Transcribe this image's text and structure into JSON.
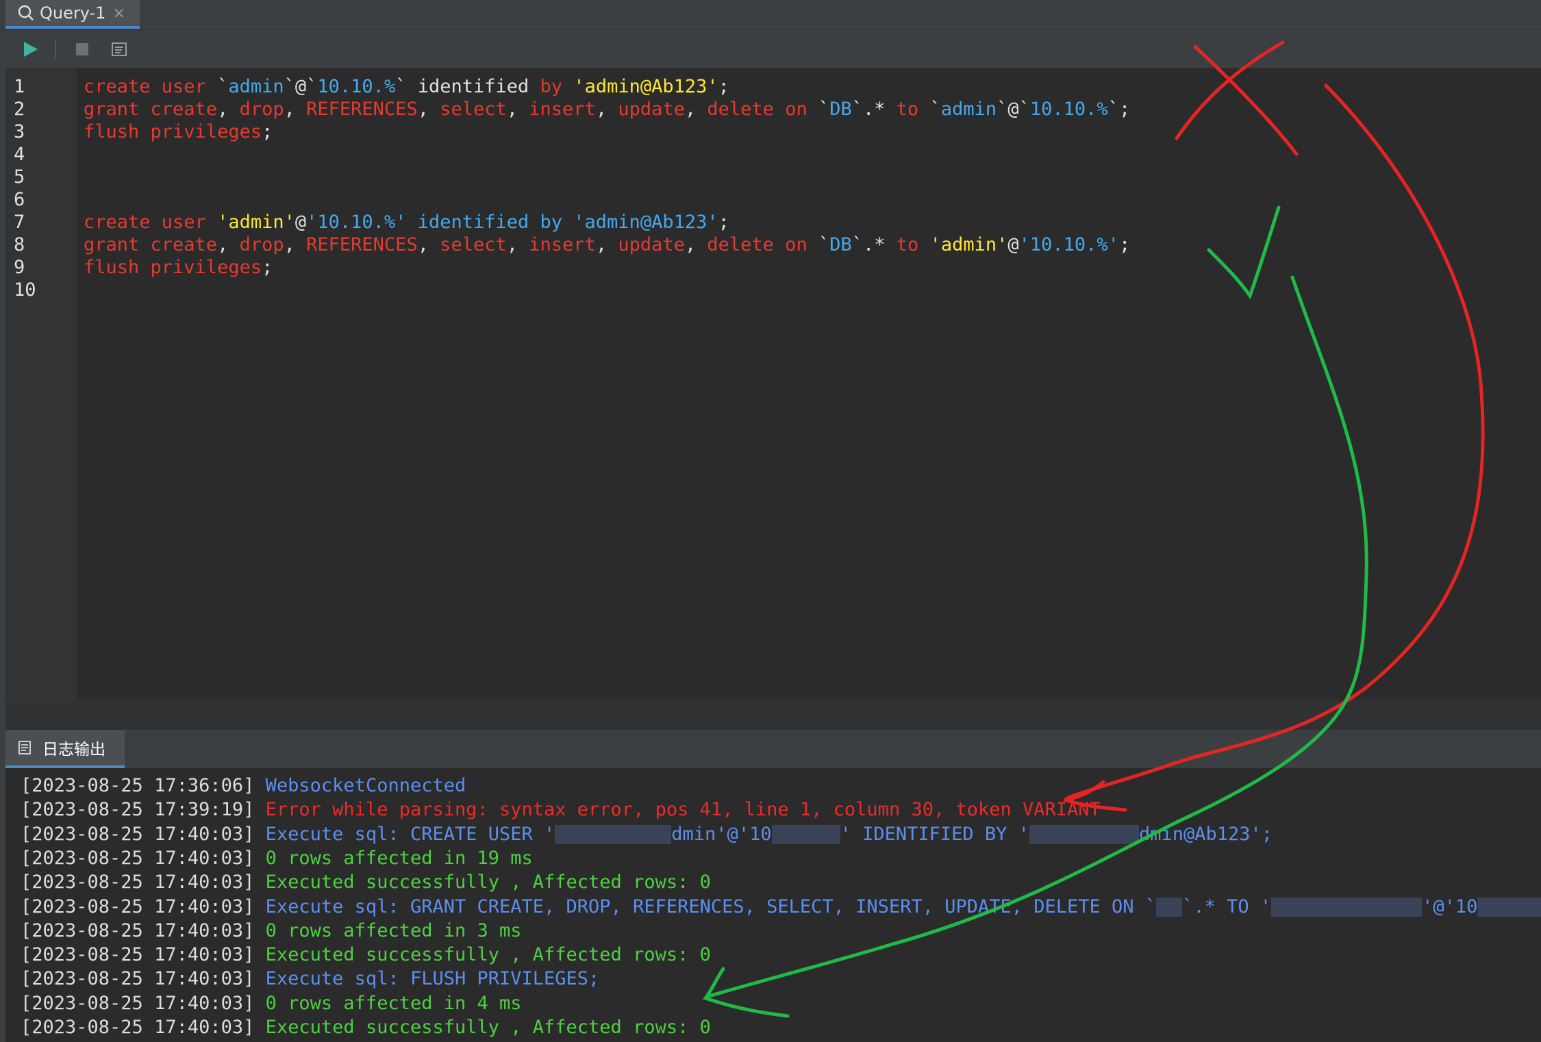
{
  "tab": {
    "title": "Query-1",
    "close_icon": "×"
  },
  "toolbar": {
    "run_icon": "play-icon",
    "stop_icon": "stop-icon",
    "format_icon": "format-icon"
  },
  "editor": {
    "lines": [
      {
        "num": "1",
        "tokens": [
          {
            "t": "create user ",
            "c": "kw"
          },
          {
            "t": "`",
            "c": "plain"
          },
          {
            "t": "admin",
            "c": "ident"
          },
          {
            "t": "`@`",
            "c": "plain"
          },
          {
            "t": "10.10.%",
            "c": "ident"
          },
          {
            "t": "` ",
            "c": "plain"
          },
          {
            "t": "identified ",
            "c": "plain"
          },
          {
            "t": "by ",
            "c": "kw"
          },
          {
            "t": "'admin@Ab123'",
            "c": "str"
          },
          {
            "t": ";",
            "c": "plain"
          }
        ]
      },
      {
        "num": "2",
        "tokens": [
          {
            "t": "grant create",
            "c": "kw"
          },
          {
            "t": ", ",
            "c": "plain"
          },
          {
            "t": "drop",
            "c": "kw"
          },
          {
            "t": ", ",
            "c": "plain"
          },
          {
            "t": "REFERENCES",
            "c": "kw"
          },
          {
            "t": ", ",
            "c": "plain"
          },
          {
            "t": "select",
            "c": "kw"
          },
          {
            "t": ", ",
            "c": "plain"
          },
          {
            "t": "insert",
            "c": "kw"
          },
          {
            "t": ", ",
            "c": "plain"
          },
          {
            "t": "update",
            "c": "kw"
          },
          {
            "t": ", ",
            "c": "plain"
          },
          {
            "t": "delete on ",
            "c": "kw"
          },
          {
            "t": "`",
            "c": "plain"
          },
          {
            "t": "DB",
            "c": "ident"
          },
          {
            "t": "`.* ",
            "c": "plain"
          },
          {
            "t": "to ",
            "c": "kw"
          },
          {
            "t": "`",
            "c": "plain"
          },
          {
            "t": "admin",
            "c": "ident"
          },
          {
            "t": "`@`",
            "c": "plain"
          },
          {
            "t": "10.10.%",
            "c": "ident"
          },
          {
            "t": "`;",
            "c": "plain"
          }
        ]
      },
      {
        "num": "3",
        "tokens": [
          {
            "t": "flush privileges",
            "c": "kw"
          },
          {
            "t": ";",
            "c": "plain"
          }
        ]
      },
      {
        "num": "4",
        "tokens": []
      },
      {
        "num": "5",
        "tokens": []
      },
      {
        "num": "6",
        "tokens": []
      },
      {
        "num": "7",
        "tokens": [
          {
            "t": "create user ",
            "c": "kw"
          },
          {
            "t": "'admin'",
            "c": "str"
          },
          {
            "t": "@",
            "c": "plain"
          },
          {
            "t": "'10.10.%' ",
            "c": "ident"
          },
          {
            "t": "identified by ",
            "c": "ident"
          },
          {
            "t": "'admin@Ab123'",
            "c": "ident"
          },
          {
            "t": ";",
            "c": "plain"
          }
        ]
      },
      {
        "num": "8",
        "tokens": [
          {
            "t": "grant create",
            "c": "kw"
          },
          {
            "t": ", ",
            "c": "plain"
          },
          {
            "t": "drop",
            "c": "kw"
          },
          {
            "t": ", ",
            "c": "plain"
          },
          {
            "t": "REFERENCES",
            "c": "kw"
          },
          {
            "t": ", ",
            "c": "plain"
          },
          {
            "t": "select",
            "c": "kw"
          },
          {
            "t": ", ",
            "c": "plain"
          },
          {
            "t": "insert",
            "c": "kw"
          },
          {
            "t": ", ",
            "c": "plain"
          },
          {
            "t": "update",
            "c": "kw"
          },
          {
            "t": ", ",
            "c": "plain"
          },
          {
            "t": "delete on ",
            "c": "kw"
          },
          {
            "t": "`",
            "c": "plain"
          },
          {
            "t": "DB",
            "c": "ident"
          },
          {
            "t": "`.* ",
            "c": "plain"
          },
          {
            "t": "to ",
            "c": "kw"
          },
          {
            "t": "'admin'",
            "c": "str"
          },
          {
            "t": "@",
            "c": "plain"
          },
          {
            "t": "'10.10.%'",
            "c": "ident"
          },
          {
            "t": ";",
            "c": "plain"
          }
        ]
      },
      {
        "num": "9",
        "tokens": [
          {
            "t": "flush privileges",
            "c": "kw"
          },
          {
            "t": ";",
            "c": "plain"
          }
        ]
      },
      {
        "num": "10",
        "tokens": []
      }
    ]
  },
  "log": {
    "tab_label": "日志输出",
    "entries": [
      {
        "ts": "[2023-08-25 17:36:06]",
        "msg": "WebsocketConnected",
        "color": "blue"
      },
      {
        "ts": "[2023-08-25 17:39:19]",
        "msg": "Error while parsing: syntax error, pos 41, line 1, column 30, token VARIANT",
        "color": "red"
      },
      {
        "ts": "[2023-08-25 17:40:03]",
        "msg": "Execute sql: CREATE USER '",
        "msg2": "dmin'@'10",
        "msg3": "' IDENTIFIED BY '",
        "msg4": "dmin@Ab123';",
        "color": "blue",
        "redacted": true
      },
      {
        "ts": "[2023-08-25 17:40:03]",
        "msg": "0 rows affected in 19 ms",
        "color": "green"
      },
      {
        "ts": "[2023-08-25 17:40:03]",
        "msg": "Executed successfully , Affected rows: 0",
        "color": "green"
      },
      {
        "ts": "[2023-08-25 17:40:03]",
        "msg": "Execute sql: GRANT CREATE, DROP, REFERENCES, SELECT, INSERT, UPDATE, DELETE ON `",
        "msg2": "`.* TO '",
        "msg3": "'@'10",
        "msg4": "';",
        "color": "blue",
        "redacted": true
      },
      {
        "ts": "[2023-08-25 17:40:03]",
        "msg": "0 rows affected in 3 ms",
        "color": "green"
      },
      {
        "ts": "[2023-08-25 17:40:03]",
        "msg": "Executed successfully , Affected rows: 0",
        "color": "green"
      },
      {
        "ts": "[2023-08-25 17:40:03]",
        "msg": "Execute sql: FLUSH PRIVILEGES;",
        "color": "blue"
      },
      {
        "ts": "[2023-08-25 17:40:03]",
        "msg": "0 rows affected in 4 ms",
        "color": "green"
      },
      {
        "ts": "[2023-08-25 17:40:03]",
        "msg": "Executed successfully , Affected rows: 0",
        "color": "green"
      }
    ]
  },
  "colors": {
    "keyword": "#e53a2f",
    "identifier": "#45a9ef",
    "string": "#ffe733",
    "log_blue": "#5b8ff0",
    "log_red": "#ec2b2b",
    "log_green": "#4cd13f",
    "accent": "#4a88c7"
  }
}
